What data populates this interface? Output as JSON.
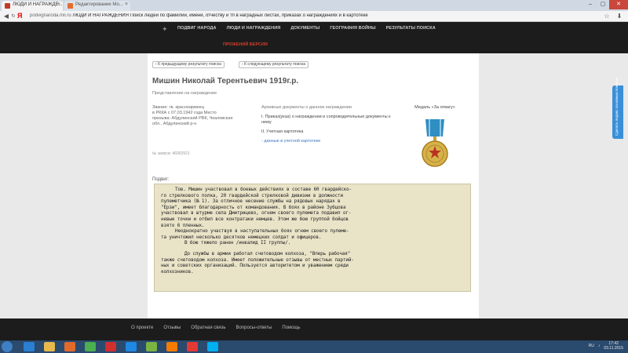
{
  "browser": {
    "tab_active": "ЛЮДИ И НАГРАЖДЕ...",
    "tab_inactive": "Редактирование Мо...",
    "address": "ЛЮДИ И НАГРАЖДЕНИЯ Поиск людей по фамилии, имени, отчеству и тп в наградных листах, приказах о награждениях и в картотеке",
    "host": "podvignaroda.mil.ru",
    "logo": "Я"
  },
  "site": {
    "nav": [
      "ПОДВИГ НАРОДА",
      "ЛЮДИ И НАГРАЖДЕНИЯ",
      "ДОКУМЕНТЫ",
      "ГЕОГРАФИЯ ВОЙНЫ",
      "РЕЗУЛЬТАТЫ ПОИСКА"
    ],
    "special_version": "ПРОЖЕНИЙ ВЕРСИЯ"
  },
  "content": {
    "prev_label": "К предыдущему результату поиска",
    "next_label": "К следующему результату поиска",
    "name": "Мишин Николай Терентьевич 1919г.р.",
    "subtitle": "Представление на награждение",
    "info_lines": [
      "Звание: гв. красноармеец",
      "в РККА с 07.03.1942 года Место",
      "призыва: Абдулинский РВК, Чкаловская",
      "обл., Абдулинский р-н"
    ],
    "record_number": "№ записи: 46902921",
    "docs_header": "Архивные документы о данном награждении",
    "doc_item_1": "I. Приказ(указ) о награждении и сопроводительные документы к нему",
    "doc_item_2": "II. Учетная картотека",
    "doc_link": "- данные в учетной картотеке",
    "medal_label": "Медаль «За отвагу»",
    "feat_label": "Подвиг:",
    "feat_lines": [
      "Тов. Мишин участвовал в боевых действиях в составе 60 гвардейско-",
      "го стрелкового полка, 20 гвардейской стрелковой дивизии в должности",
      "пулеметчика (№ 1). За отличное несение службы на рядовых нарядах в",
      "\"Ерзи\", имеет благодарность от командования. В боях в районе Зубцова",
      "участвовал в штурме села Дмитрицево, огнем своего пулемета подавил ог-",
      "невые точки и отбил все контратаки немцев. Этом же бою группой бойцов",
      "взято 6 пленных.",
      "Неоднократно участвуя в наступательных боях огнем своего пулеме-",
      "та уничтожил несколько десятков немецких солдат и офицеров.",
      "В бою тяжело ранен /инвалид II группы/.",
      "До службы в армии работал счетоводом колхоза, \"Вперь рабочая\"",
      "также счетоводом колхоза. Имеет положительные отзывы от местных партий-",
      "ных и советских организаций. Пользуется авторитетом и уважением среди",
      "колхозников."
    ]
  },
  "side_widget": "Сделать яндекс основным поиском",
  "footer": {
    "links": [
      "О проекте",
      "Отзывы",
      "Обратная связь",
      "Вопросы-ответы",
      "Помощь"
    ]
  },
  "taskbar": {
    "lang": "RU",
    "time": "17:42",
    "date": "03.11.2015"
  },
  "colors": {
    "header_bg": "#1c1c1c",
    "accent_red": "#d43b2a",
    "link_blue": "#3a77c2",
    "scan_bg": "#e9e3c8"
  }
}
